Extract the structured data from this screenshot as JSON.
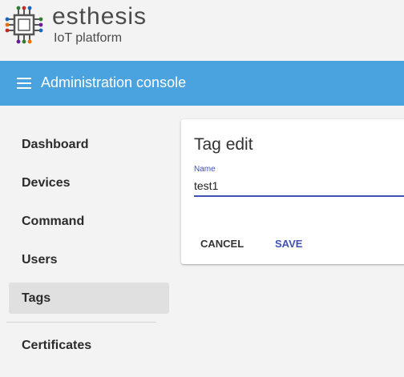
{
  "brand": {
    "name": "esthesis",
    "subtitle": "IoT platform"
  },
  "toolbar": {
    "title": "Administration console",
    "menu_icon": "menu-icon"
  },
  "sidebar": {
    "items": [
      {
        "label": "Dashboard"
      },
      {
        "label": "Devices"
      },
      {
        "label": "Command"
      },
      {
        "label": "Users"
      },
      {
        "label": "Tags",
        "active": true
      },
      {
        "label": "Certificates"
      }
    ]
  },
  "tag_edit": {
    "title": "Tag edit",
    "name_label": "Name",
    "name_value": "test1",
    "cancel_label": "CANCEL",
    "save_label": "SAVE"
  },
  "colors": {
    "toolbar": "#4aa3df",
    "accent": "#3f51b5",
    "active_item": "#e0e0e0"
  }
}
